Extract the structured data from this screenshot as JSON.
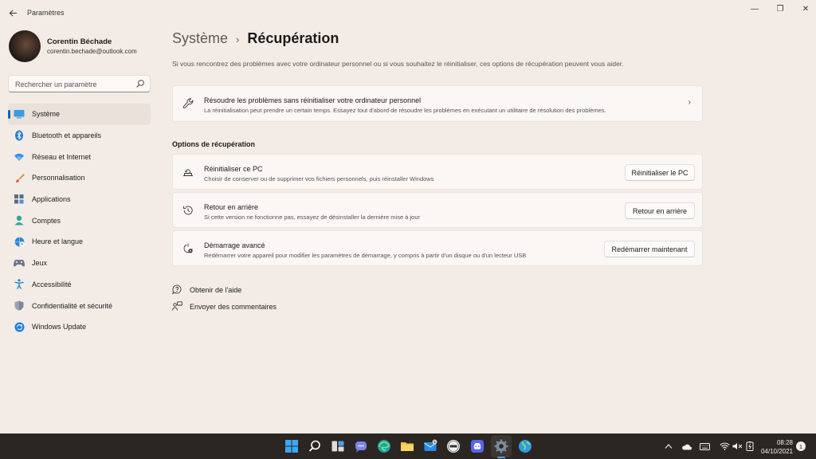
{
  "window": {
    "app_title": "Paramètres",
    "controls": {
      "minimize": "—",
      "maximize": "❐",
      "close": "✕"
    }
  },
  "profile": {
    "name": "Corentin Béchade",
    "email": "corentin.bechade@outlook.com"
  },
  "search": {
    "placeholder": "Rechercher un paramètre"
  },
  "nav": {
    "items": [
      {
        "label": "Système",
        "icon": "system-icon",
        "active": true
      },
      {
        "label": "Bluetooth et appareils",
        "icon": "bluetooth-icon"
      },
      {
        "label": "Réseau et Internet",
        "icon": "network-icon"
      },
      {
        "label": "Personnalisation",
        "icon": "brush-icon"
      },
      {
        "label": "Applications",
        "icon": "apps-icon"
      },
      {
        "label": "Comptes",
        "icon": "accounts-icon"
      },
      {
        "label": "Heure et langue",
        "icon": "globe-clock-icon"
      },
      {
        "label": "Jeux",
        "icon": "gamepad-icon"
      },
      {
        "label": "Accessibilité",
        "icon": "accessibility-icon"
      },
      {
        "label": "Confidentialité et sécurité",
        "icon": "shield-icon"
      },
      {
        "label": "Windows Update",
        "icon": "windows-update-icon"
      }
    ]
  },
  "breadcrumb": {
    "parent": "Système",
    "separator": "›",
    "current": "Récupération"
  },
  "intro": "Si vous rencontrez des problèmes avec votre ordinateur personnel ou si vous souhaitez le réinitialiser, ces options de récupération peuvent vous aider.",
  "troubleshoot_card": {
    "title": "Résoudre les problèmes sans réinitialiser votre ordinateur personnel",
    "desc": "La réinitialisation peut prendre un certain temps. Essayez tout d'abord de résoudre les problèmes en exécutant un utilitaire de résolution des problèmes.",
    "chevron": "›"
  },
  "section_title": "Options de récupération",
  "options": [
    {
      "title": "Réinitialiser ce PC",
      "desc": "Choisir de conserver ou de supprimer vos fichiers personnels, puis réinstaller Windows",
      "button": "Réinitialiser le PC"
    },
    {
      "title": "Retour en arrière",
      "desc": "Si cette version ne fonctionne pas, essayez de désinstaller la dernière mise à jour",
      "button": "Retour en arrière"
    },
    {
      "title": "Démarrage avancé",
      "desc": "Redémarrer votre appareil pour modifier les paramètres de démarrage, y compris à partir d'un disque ou d'un lecteur USB",
      "button": "Redémarrer maintenant"
    }
  ],
  "links": [
    {
      "label": "Obtenir de l'aide",
      "icon": "help-icon"
    },
    {
      "label": "Envoyer des commentaires",
      "icon": "feedback-icon"
    }
  ],
  "taskbar": {
    "time": "08:28",
    "date": "04/10/2021",
    "mail_badge": "1",
    "notification_count": "1",
    "accent": "#0067c0"
  }
}
